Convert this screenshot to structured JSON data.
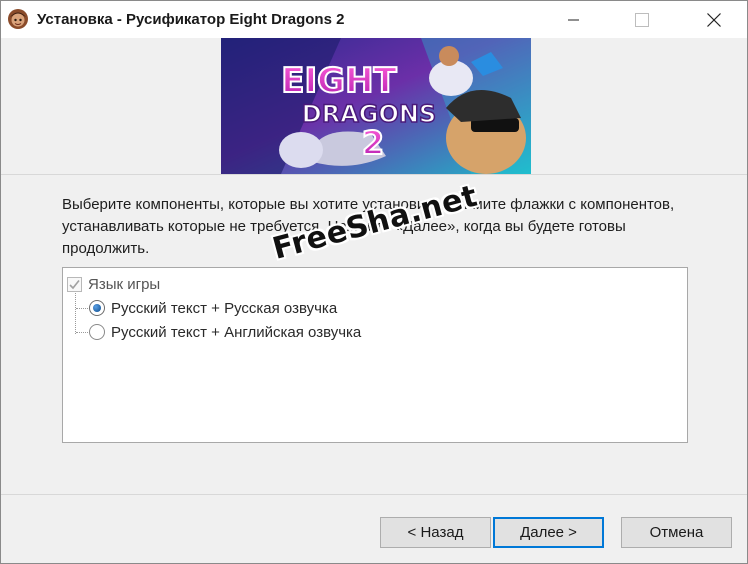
{
  "window": {
    "title": "Установка - Русификатор Eight Dragons 2"
  },
  "banner": {
    "logo_line1": "EIGHT",
    "logo_line2": "DRAGONS",
    "logo_line3": "2"
  },
  "main": {
    "description": "Выберите компоненты, которые вы хотите установить; снимите флажки с компонентов, устанавливать которые не требуется. Нажмите «Далее», когда вы будете готовы продолжить.",
    "components": {
      "parent": {
        "label": "Язык игры",
        "checked": true,
        "disabled": true
      },
      "options": [
        {
          "label": "Русский текст + Русская озвучка",
          "selected": true
        },
        {
          "label": "Русский текст + Английская озвучка",
          "selected": false
        }
      ]
    }
  },
  "buttons": {
    "back": "< Назад",
    "next": "Далее >",
    "cancel": "Отмена"
  },
  "watermark": "FreeSha.net",
  "colors": {
    "accent": "#0078d7",
    "window_bg": "#f0f0f0",
    "banner_magenta": "#d62bb8",
    "banner_cyan": "#37d6e6"
  }
}
